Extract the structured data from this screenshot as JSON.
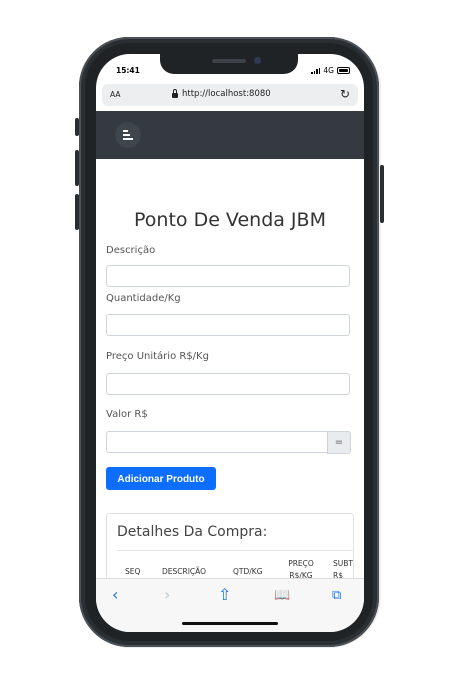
{
  "status": {
    "time": "15:41",
    "network": "4G"
  },
  "browser": {
    "aa_label": "AA",
    "url": "http://localhost:8080",
    "reload_icon": "reload-icon"
  },
  "navbar": {
    "toggler_icon": "menu-icon"
  },
  "page": {
    "title": "Ponto De Venda JBM"
  },
  "form": {
    "descricao_label": "Descrição",
    "descricao_value": "",
    "quantidade_label": "Quantidade/Kg",
    "quantidade_value": "",
    "preco_label": "Preço Unitário R$/Kg",
    "preco_value": "",
    "valor_label": "Valor R$",
    "valor_value": "",
    "equals_label": "=",
    "add_button_label": "Adicionar Produto"
  },
  "details": {
    "title": "Detalhes Da Compra:",
    "columns": [
      "SEQ",
      "DESCRIÇÃO",
      "QTD/KG",
      "PREÇO R$/KG",
      "SUBTO R$"
    ]
  },
  "toolbar": {
    "icons": [
      "back-icon",
      "forward-icon",
      "share-icon",
      "bookmarks-icon",
      "tabs-icon"
    ]
  }
}
